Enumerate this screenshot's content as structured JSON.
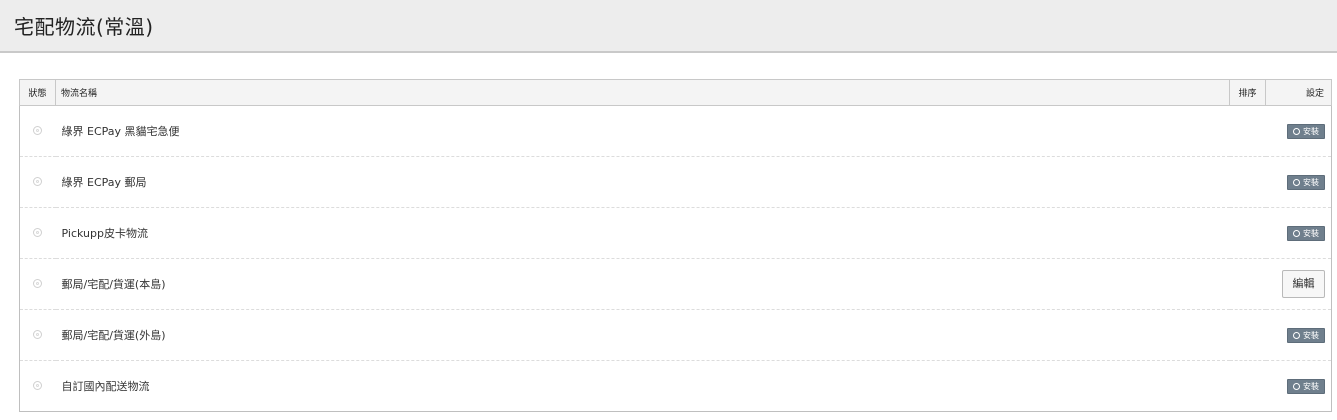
{
  "page": {
    "title": "宅配物流(常溫)"
  },
  "table": {
    "headers": {
      "status": "狀態",
      "name": "物流名稱",
      "sort": "排序",
      "settings": "設定"
    },
    "rows": [
      {
        "name": "綠界 ECPay 黑貓宅急便",
        "status_icon": "radio-off-icon",
        "action": {
          "type": "install",
          "label": "安裝",
          "icon": "circle-icon"
        }
      },
      {
        "name": "綠界 ECPay 郵局",
        "status_icon": "radio-off-icon",
        "action": {
          "type": "install",
          "label": "安裝",
          "icon": "circle-icon"
        }
      },
      {
        "name": "Pickupp皮卡物流",
        "status_icon": "radio-off-icon",
        "action": {
          "type": "install",
          "label": "安裝",
          "icon": "circle-icon"
        }
      },
      {
        "name": "郵局/宅配/貨運(本島)",
        "status_icon": "radio-off-icon",
        "action": {
          "type": "edit",
          "label": "編輯"
        }
      },
      {
        "name": "郵局/宅配/貨運(外島)",
        "status_icon": "radio-off-icon",
        "action": {
          "type": "install",
          "label": "安裝",
          "icon": "circle-icon"
        }
      },
      {
        "name": "自訂國內配送物流",
        "status_icon": "radio-off-icon",
        "action": {
          "type": "install",
          "label": "安裝",
          "icon": "circle-icon"
        }
      }
    ]
  },
  "colors": {
    "install_button": "#6f7f8d",
    "header_bg": "#ededed"
  }
}
